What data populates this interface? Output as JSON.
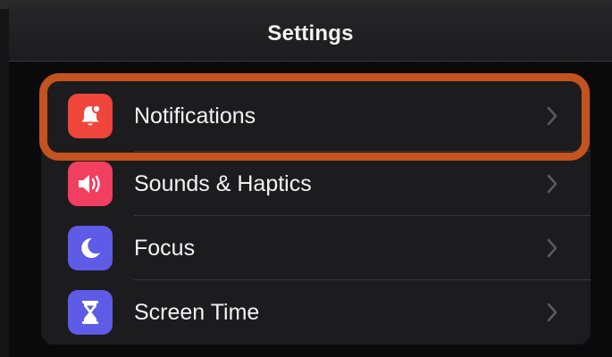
{
  "nav": {
    "title": "Settings"
  },
  "settings_list": {
    "items": [
      {
        "label": "Notifications",
        "icon": "bell-badge-icon",
        "icon_color": "#f0453a",
        "highlighted": true
      },
      {
        "label": "Sounds & Haptics",
        "icon": "speaker-wave-icon",
        "icon_color": "#f23e5f",
        "highlighted": false
      },
      {
        "label": "Focus",
        "icon": "moon-icon",
        "icon_color": "#5e5ce6",
        "highlighted": false
      },
      {
        "label": "Screen Time",
        "icon": "hourglass-icon",
        "icon_color": "#5e5ce6",
        "highlighted": false
      }
    ]
  },
  "colors": {
    "highlight_outline": "#c4531f",
    "row_background": "#1c1c1e",
    "text": "#f2f2f7",
    "chevron": "#5a5a5e"
  }
}
